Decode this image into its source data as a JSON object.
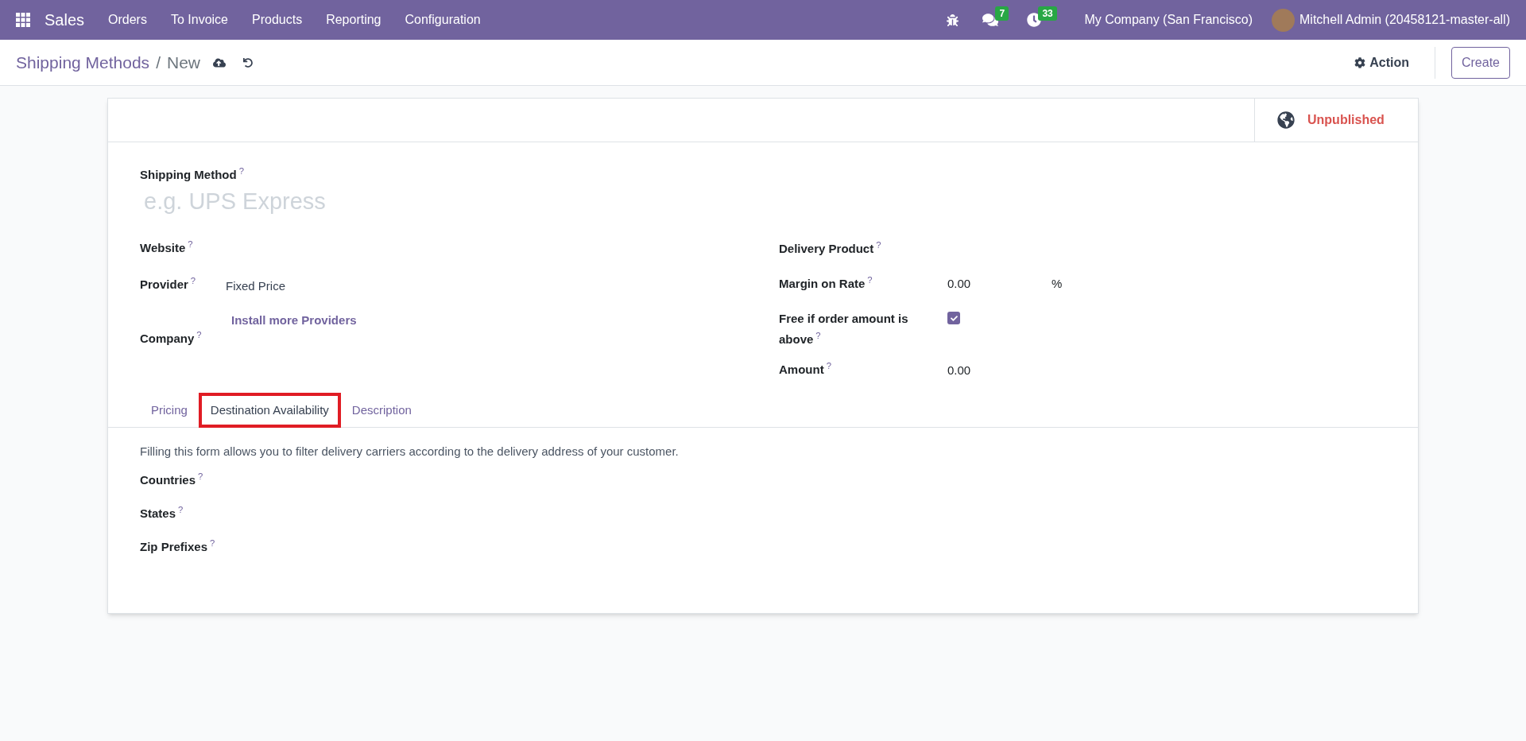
{
  "navbar": {
    "app_name": "Sales",
    "menu": [
      "Orders",
      "To Invoice",
      "Products",
      "Reporting",
      "Configuration"
    ],
    "messages_count": "7",
    "activities_count": "33",
    "company": "My Company (San Francisco)",
    "user": "Mitchell Admin (20458121-master-all)"
  },
  "breadcrumb": {
    "parent": "Shipping Methods",
    "separator": "/",
    "current": "New"
  },
  "control_panel": {
    "action": "Action",
    "create": "Create"
  },
  "publish": {
    "label": "Unpublished",
    "published": false
  },
  "form": {
    "name_label": "Shipping Method",
    "name_help": "?",
    "name_placeholder": "e.g. UPS Express",
    "left_fields": [
      {
        "label": "Website",
        "help": "?"
      },
      {
        "label": "Provider",
        "help": "?",
        "value": "Fixed Price",
        "link": "Install more Providers"
      },
      {
        "label": "Company",
        "help": "?"
      }
    ],
    "right_fields": [
      {
        "kind": "empty",
        "label": "Delivery Product",
        "help": "?"
      },
      {
        "kind": "percent",
        "label": "Margin on Rate",
        "help": "?",
        "value": "0.00",
        "suffix": "%"
      },
      {
        "kind": "checkbox",
        "label": "Free if order amount is above",
        "help": "?",
        "checked": true
      },
      {
        "kind": "number",
        "label": "Amount",
        "help": "?",
        "value": "0.00"
      }
    ]
  },
  "tabs": [
    {
      "label": "Pricing",
      "selected": false,
      "highlighted": false
    },
    {
      "label": "Destination Availability",
      "selected": true,
      "highlighted": true
    },
    {
      "label": "Description",
      "selected": false,
      "highlighted": false
    }
  ],
  "tab_content": {
    "intro": "Filling this form allows you to filter delivery carriers according to the delivery address of your customer.",
    "fields": [
      {
        "label": "Countries",
        "help": "?"
      },
      {
        "label": "States",
        "help": "?"
      },
      {
        "label": "Zip Prefixes",
        "help": "?"
      }
    ]
  }
}
